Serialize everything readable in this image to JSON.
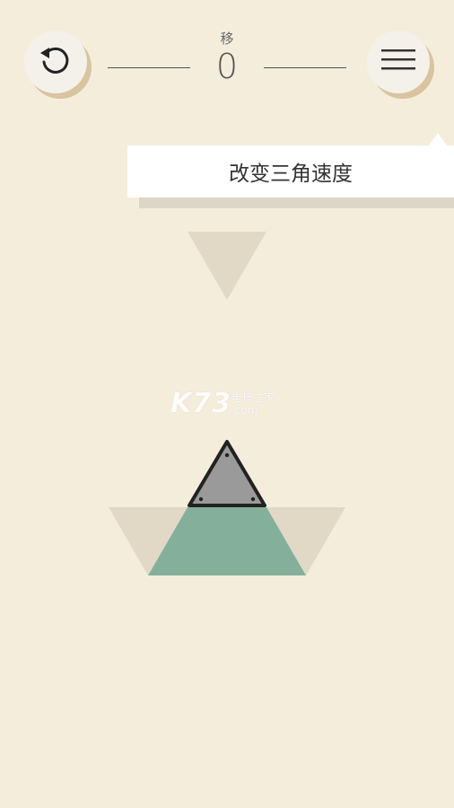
{
  "header": {
    "moves_label": "移",
    "moves_count": "0"
  },
  "tooltip": {
    "text": "改变三角速度"
  },
  "watermark": {
    "brand": "K73",
    "site_name": "电玩之家",
    "domain": ".com"
  },
  "icons": {
    "undo": "undo-icon",
    "menu": "hamburger-menu-icon"
  },
  "colors": {
    "background": "#f5eddc",
    "ghost_triangle": "#ddd5c2",
    "green_triangle": "#84b09b",
    "gray_triangle": "#9a9a9a",
    "button_shadow": "#d8c49e"
  }
}
